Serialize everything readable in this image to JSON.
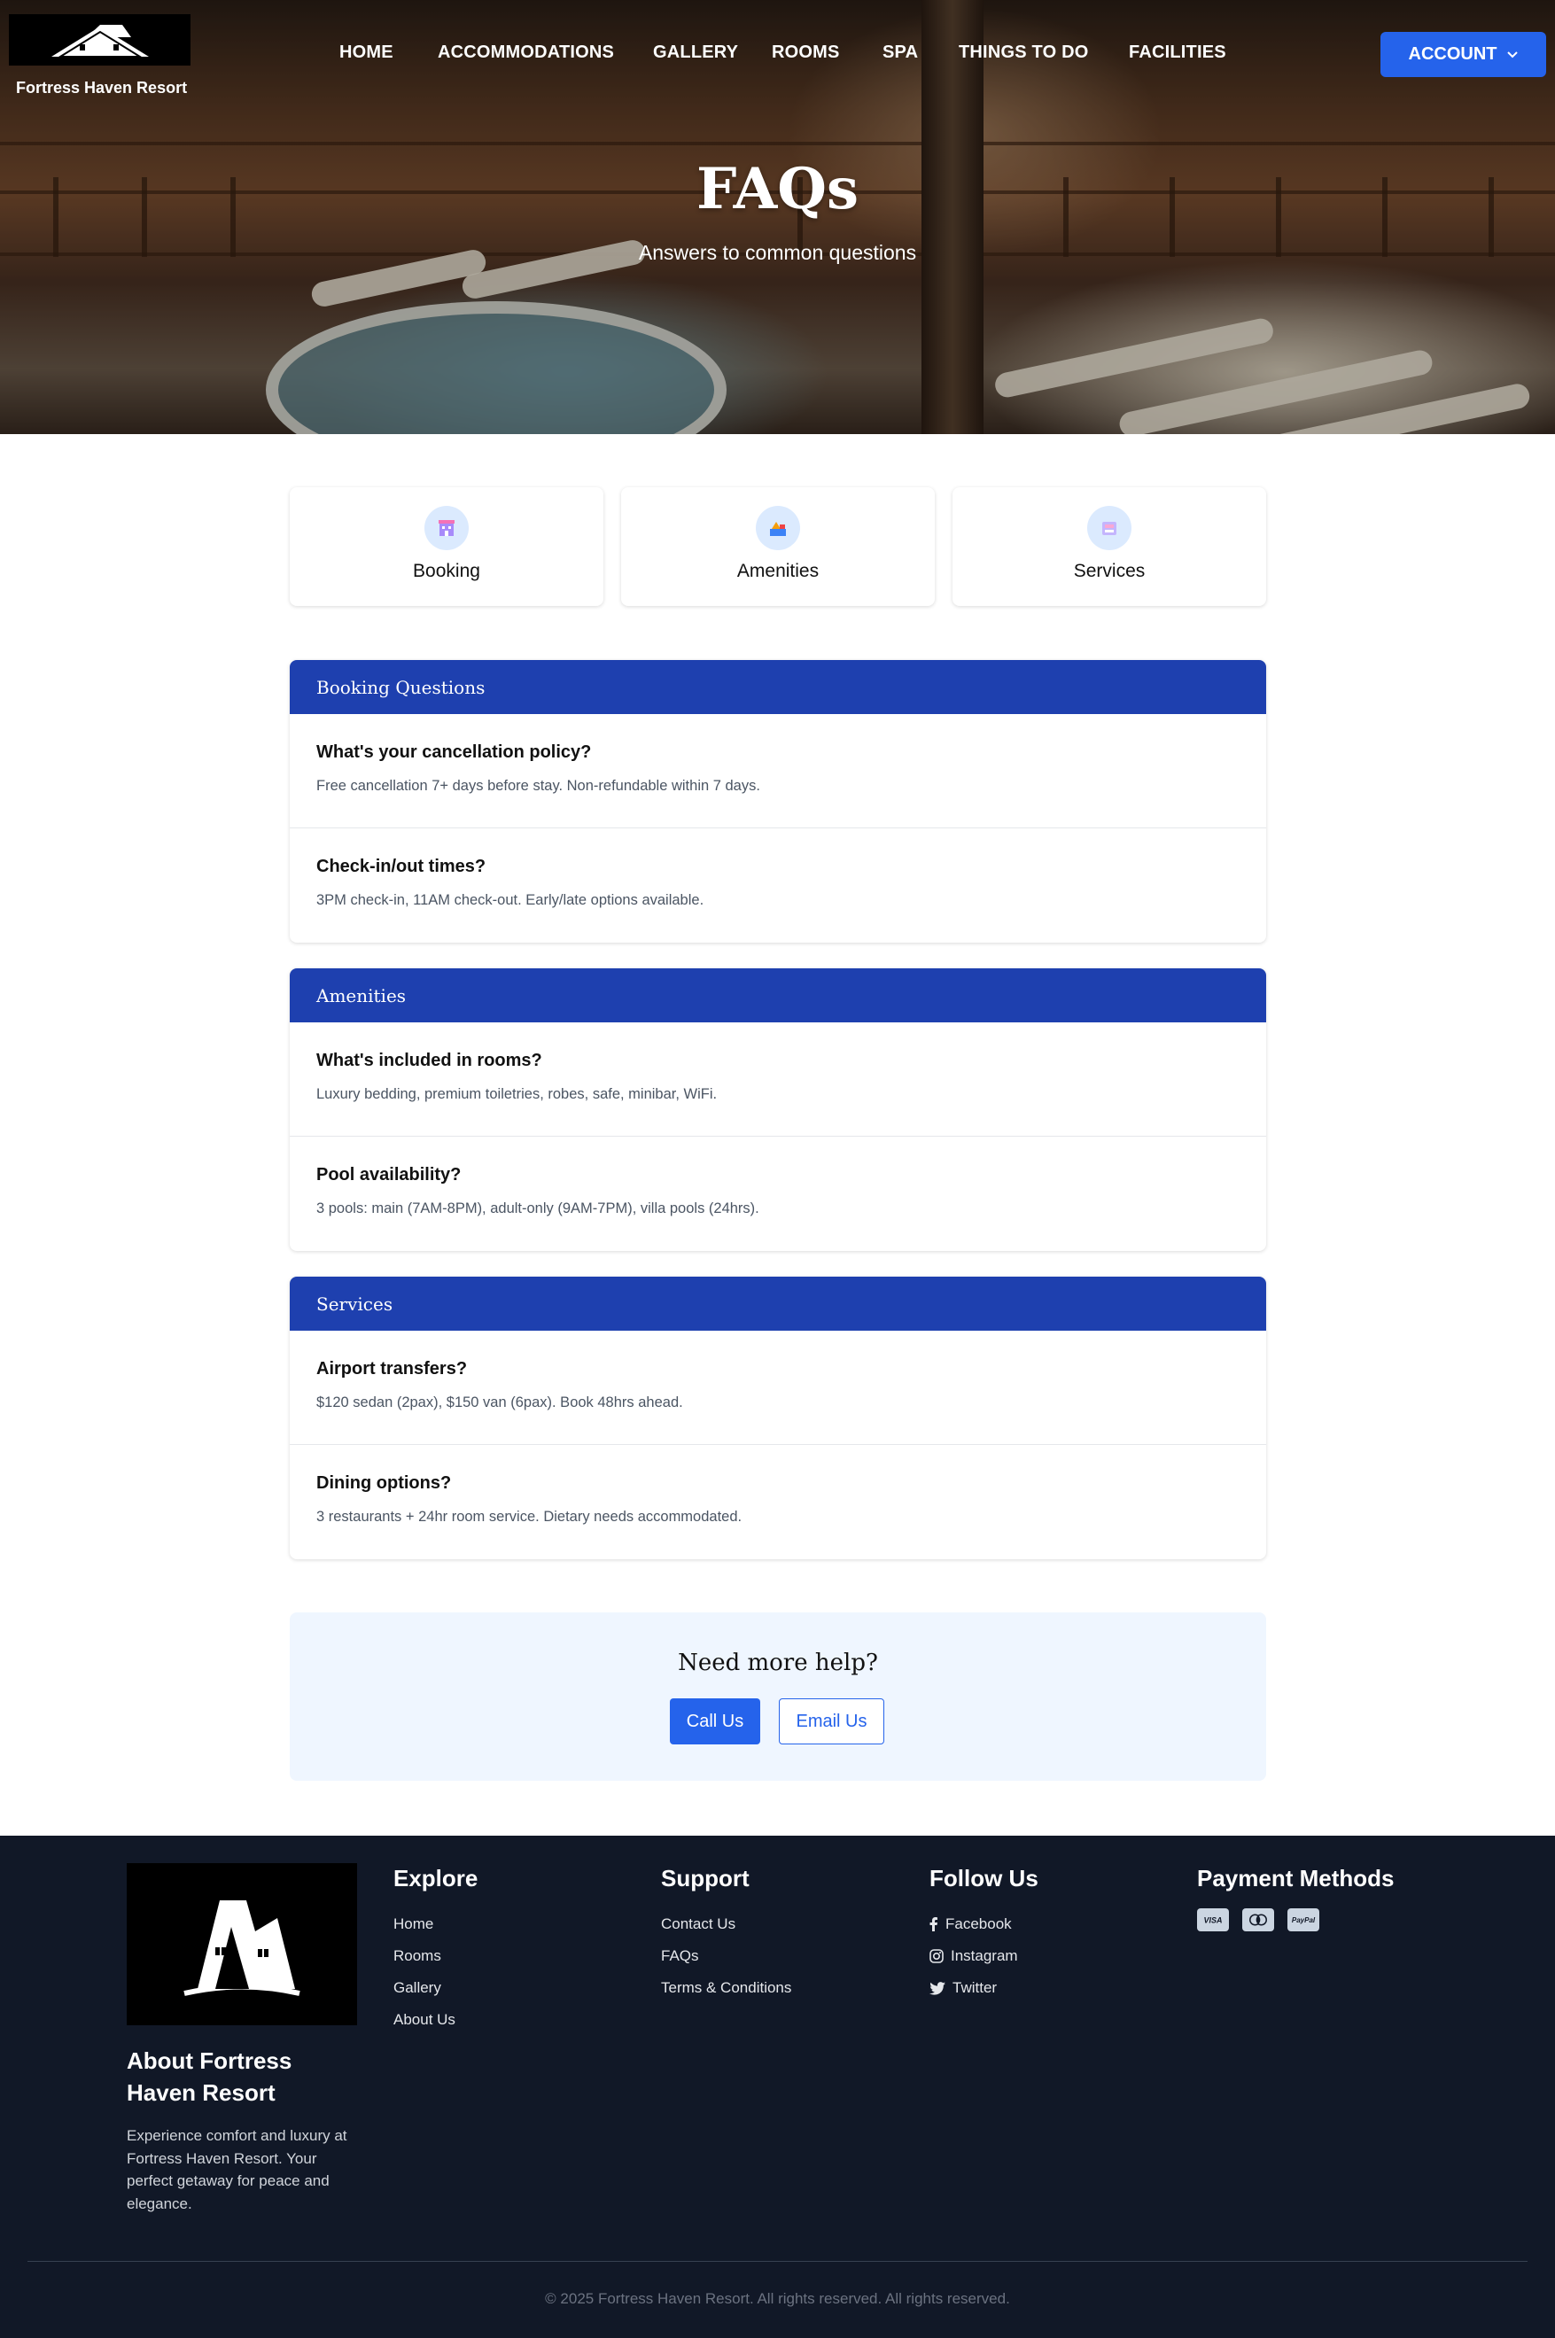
{
  "brand": {
    "name": "Fortress Haven Resort"
  },
  "nav": {
    "items": [
      {
        "label": "HOME"
      },
      {
        "label": "ACCOMMODATIONS"
      },
      {
        "label": "GALLERY"
      },
      {
        "label": "ROOMS"
      },
      {
        "label": "SPA"
      },
      {
        "label": "THINGS TO DO"
      },
      {
        "label": "FACILITIES"
      }
    ],
    "account_label": "ACCOUNT"
  },
  "hero": {
    "title": "FAQs",
    "subtitle": "Answers to common questions"
  },
  "categories": [
    {
      "label": "Booking",
      "icon": "hotel-icon"
    },
    {
      "label": "Amenities",
      "icon": "amenities-icon"
    },
    {
      "label": "Services",
      "icon": "services-icon"
    }
  ],
  "sections": [
    {
      "title": "Booking Questions",
      "questions": [
        {
          "q": "What's your cancellation policy?",
          "a": "Free cancellation 7+ days before stay. Non-refundable within 7 days."
        },
        {
          "q": "Check-in/out times?",
          "a": "3PM check-in, 11AM check-out. Early/late options available."
        }
      ]
    },
    {
      "title": "Amenities",
      "questions": [
        {
          "q": "What's included in rooms?",
          "a": "Luxury bedding, premium toiletries, robes, safe, minibar, WiFi."
        },
        {
          "q": "Pool availability?",
          "a": "3 pools: main (7AM-8PM), adult-only (9AM-7PM), villa pools (24hrs)."
        }
      ]
    },
    {
      "title": "Services",
      "questions": [
        {
          "q": "Airport transfers?",
          "a": "$120 sedan (2pax), $150 van (6pax). Book 48hrs ahead."
        },
        {
          "q": "Dining options?",
          "a": "3 restaurants + 24hr room service. Dietary needs accommodated."
        }
      ]
    }
  ],
  "help": {
    "title": "Need more help?",
    "call_label": "Call Us",
    "email_label": "Email Us"
  },
  "footer": {
    "about_title": "About Fortress Haven Resort",
    "about_text": "Experience comfort and luxury at Fortress Haven Resort. Your perfect getaway for peace and elegance.",
    "explore": {
      "title": "Explore",
      "links": [
        "Home",
        "Rooms",
        "Gallery",
        "About Us"
      ]
    },
    "support": {
      "title": "Support",
      "links": [
        "Contact Us",
        "FAQs",
        "Terms & Conditions"
      ]
    },
    "follow": {
      "title": "Follow Us",
      "links": [
        "Facebook",
        "Instagram",
        "Twitter"
      ]
    },
    "payment": {
      "title": "Payment Methods",
      "methods": [
        "VISA",
        "Mastercard",
        "PayPal"
      ]
    },
    "copyright": "© 2025 Fortress Haven Resort. All rights reserved. All rights reserved."
  },
  "colors": {
    "primary": "#2563eb",
    "section_header": "#1e40af",
    "footer_bg": "#111827",
    "help_bg": "#eff6ff"
  }
}
